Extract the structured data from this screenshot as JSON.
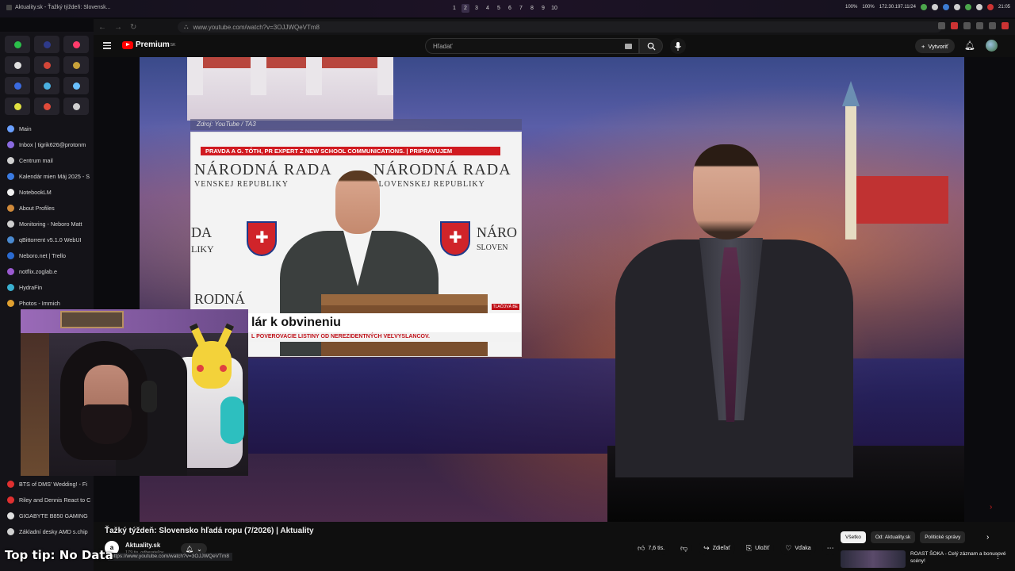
{
  "system": {
    "window_title": "Aktuality.sk - Ťažký týždeň: Slovensk...",
    "workspaces": [
      "1",
      "2",
      "3",
      "4",
      "5",
      "6",
      "7",
      "8",
      "9",
      "10"
    ],
    "active_workspace": "2",
    "status": [
      "100%",
      "100%",
      "172.30.197.11/24"
    ],
    "clock": "21:05"
  },
  "browser": {
    "url": "www.youtube.com/watch?v=3OJJWQeVTm8",
    "hover_url": "https://www.youtube.com/watch?v=3OJJWQeVTm8"
  },
  "sidebar": {
    "pinned_colors": [
      "#2bbf4a",
      "#2e3a8a",
      "#ff3b6b",
      "#e0e0e0",
      "#d44638",
      "#c8a23a",
      "#3a6ae0",
      "#4ab0e0",
      "#6ac0ff",
      "#e0e040",
      "#e04a3a",
      "#cfcfcf"
    ],
    "items": [
      {
        "label": "Main",
        "color": "#6aa0ff"
      },
      {
        "label": "Inbox | tigrik626@protonm",
        "color": "#8a6ae0"
      },
      {
        "label": "Centrum mail",
        "color": "#d0d0d0"
      },
      {
        "label": "Kalendár mien Máj 2025 - S",
        "color": "#3a7ae0"
      },
      {
        "label": "NotebookLM",
        "color": "#f0f0f0"
      },
      {
        "label": "About Profiles",
        "color": "#d08a3a"
      },
      {
        "label": "Monitoring - Neboro Matt",
        "color": "#cfcfcf"
      },
      {
        "label": "qBittorrent v5.1.0 WebUI",
        "color": "#4a8ad0"
      },
      {
        "label": "Neboro.net | Trello",
        "color": "#2a6ad0"
      },
      {
        "label": "notflix.zoglab.e",
        "color": "#9a5ad0"
      },
      {
        "label": "HydraFin",
        "color": "#3ab0d0"
      },
      {
        "label": "Photos - Immich",
        "color": "#e0a030"
      }
    ],
    "lower_items": [
      {
        "label": "BTS of DMS' Wedding! - Fi",
        "color": "#e03030"
      },
      {
        "label": "Riley and Dennis React to C",
        "color": "#e03030"
      },
      {
        "label": "GIGABYTE B850 GAMING",
        "color": "#e0e0e0"
      },
      {
        "label": "Základní desky AMD s.chip",
        "color": "#d0d0d0"
      }
    ]
  },
  "youtube": {
    "brand": "Premium",
    "brand_sup": "SK",
    "search_placeholder": "Hľadať",
    "create_label": "Vytvoriť"
  },
  "video_frame": {
    "source_caption": "Zdroj: YouTube / TA3",
    "ticker": "PRAVDA A G. TÓTH, PR EXPERT Z NEW SCHOOL COMMUNICATIONS. | PRIPRAVUJEM",
    "wall_line1": "NÁRODNÁ RADA",
    "wall_line2_left": "VENSKEJ REPUBLIKY",
    "wall_line2_right": "SLOVENSKEJ REPUBLIKY",
    "wall_left_a": "DA",
    "wall_left_b": "LIKY",
    "wall_right_a": "NÁRO",
    "wall_right_b": "SLOVEN",
    "wall_bottom": "RODNÁ",
    "headline": "lár k obvineniu",
    "subheadline": "L POVEROVACIE LISTINY OD NEREZIDENTNÝCH VEĽVYSLANCOV.",
    "channel_tag": "TLAČOVÁ BE"
  },
  "video": {
    "title": "Ťažký týždeň: Slovensko hľadá ropu (7/2026) | Aktuality",
    "channel": "Aktuality.sk",
    "channel_initial": "a",
    "subscribers": "179 tis. odberateľov",
    "likes": "7,6 tis.",
    "share": "Zdieľať",
    "save": "Uložiť",
    "thanks": "Vďaka"
  },
  "chips": [
    "Všetko",
    "Od: Aktuality.sk",
    "Politické správy"
  ],
  "recommended": {
    "title": "ROAST ŠOKA - Celý záznam a bonusové scény!"
  },
  "overlay_text": "Top tip: No Data"
}
